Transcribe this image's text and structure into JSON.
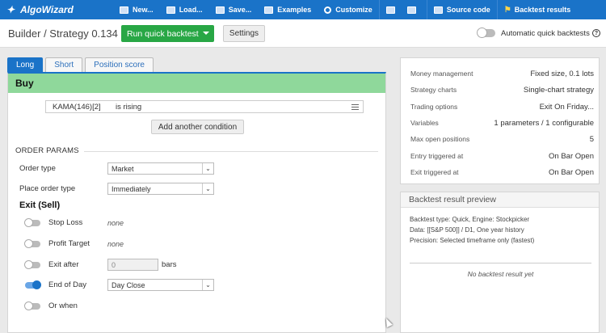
{
  "topbar": {
    "brand": "AlgoWizard",
    "items": [
      {
        "label": "New...",
        "icon": "file-new-icon"
      },
      {
        "label": "Load...",
        "icon": "folder-open-icon"
      },
      {
        "label": "Save...",
        "icon": "save-icon"
      },
      {
        "label": "Examples",
        "icon": "examples-icon"
      },
      {
        "label": "Customize",
        "icon": "gear-icon"
      },
      {
        "label": "Source code",
        "icon": "code-icon"
      },
      {
        "label": "Backtest results",
        "icon": "flag-icon"
      }
    ]
  },
  "header": {
    "title": "Builder / Strategy 0.134",
    "run_button": "Run quick backtest",
    "settings_button": "Settings",
    "auto_label": "Automatic quick backtests",
    "help": "?"
  },
  "tabs": [
    {
      "label": "Long",
      "active": true
    },
    {
      "label": "Short",
      "active": false
    },
    {
      "label": "Position score",
      "active": false
    }
  ],
  "buy": {
    "title": "Buy",
    "condition": {
      "indicator": "KAMA(146)[2]",
      "operator": "is rising"
    },
    "add_button": "Add another condition"
  },
  "order_params": {
    "title": "ORDER PARAMS",
    "order_type_label": "Order type",
    "order_type_value": "Market",
    "place_label": "Place order type",
    "place_value": "Immediately"
  },
  "exit": {
    "title": "Exit (Sell)",
    "stop_loss_label": "Stop Loss",
    "stop_loss_value": "none",
    "profit_label": "Profit Target",
    "profit_value": "none",
    "exit_after_label": "Exit after",
    "exit_after_value": "0",
    "exit_after_unit": "bars",
    "eod_label": "End of Day",
    "eod_value": "Day Close",
    "or_when_label": "Or when"
  },
  "info": [
    {
      "key": "Money management",
      "value": "Fixed size, 0.1 lots"
    },
    {
      "key": "Strategy charts",
      "value": "Single-chart strategy"
    },
    {
      "key": "Trading options",
      "value": "Exit On Friday..."
    },
    {
      "key": "Variables",
      "value": "1 parameters / 1 configurable"
    },
    {
      "key": "Max open positions",
      "value": "5"
    },
    {
      "key": "Entry triggered at",
      "value": "On Bar Open"
    },
    {
      "key": "Exit triggered at",
      "value": "On Bar Open"
    }
  ],
  "preview": {
    "title": "Backtest result preview",
    "line1": "Backtest type: Quick, Engine: Stockpicker",
    "line2": "Data: [[S&P 500]] / D1, One year history",
    "line3": "Precision: Selected timeframe only (fastest)",
    "no_result": "No backtest result yet"
  },
  "colors": {
    "topbar": "#1a73c8",
    "run": "#28a745",
    "buy_bar": "#8fd89b"
  }
}
